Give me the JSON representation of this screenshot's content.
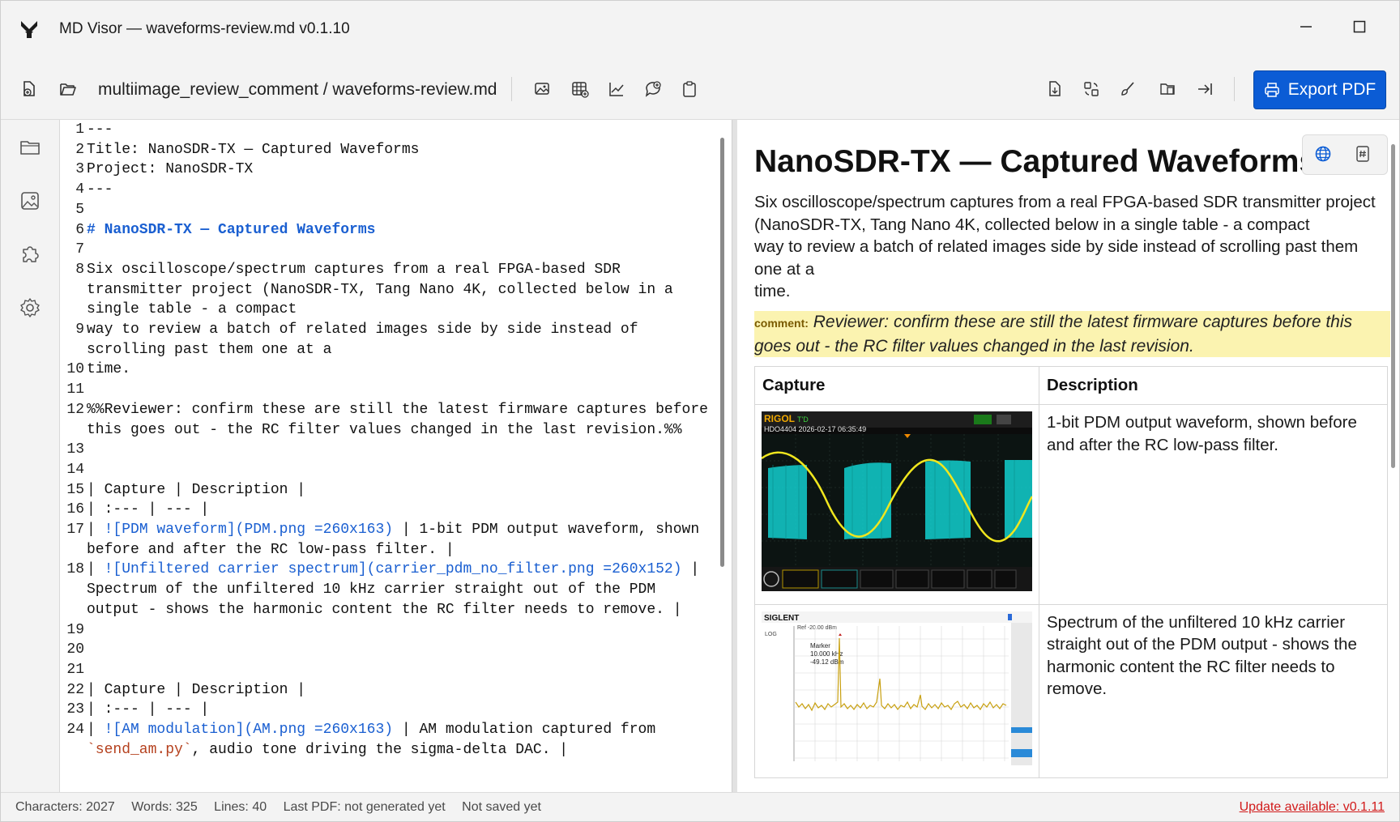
{
  "window": {
    "title": "MD Visor — waveforms-review.md v0.1.10"
  },
  "toolbar": {
    "breadcrumb": "multiimage_review_comment / waveforms-review.md",
    "export_label": "Export PDF"
  },
  "editor": {
    "lines": [
      {
        "n": "1",
        "segs": [
          {
            "t": "---"
          }
        ]
      },
      {
        "n": "2",
        "segs": [
          {
            "t": "Title: NanoSDR-TX — Captured Waveforms"
          }
        ]
      },
      {
        "n": "3",
        "segs": [
          {
            "t": "Project: NanoSDR-TX"
          }
        ]
      },
      {
        "n": "4",
        "segs": [
          {
            "t": "---"
          }
        ]
      },
      {
        "n": "5",
        "segs": [
          {
            "t": ""
          }
        ]
      },
      {
        "n": "6",
        "segs": [
          {
            "t": "# NanoSDR-TX — Captured Waveforms",
            "c": "md-h"
          }
        ]
      },
      {
        "n": "7",
        "segs": [
          {
            "t": ""
          }
        ]
      },
      {
        "n": "8",
        "segs": [
          {
            "t": "Six oscilloscope/spectrum captures from a real FPGA-based SDR transmitter project (NanoSDR-TX, Tang Nano 4K, collected below in a single table - a compact"
          }
        ]
      },
      {
        "n": "9",
        "segs": [
          {
            "t": "way to review a batch of related images side by side instead of scrolling past them one at a"
          }
        ]
      },
      {
        "n": "10",
        "segs": [
          {
            "t": "time."
          }
        ]
      },
      {
        "n": "11",
        "segs": [
          {
            "t": ""
          }
        ]
      },
      {
        "n": "12",
        "segs": [
          {
            "t": "%%Reviewer: confirm these are still the latest firmware captures before this goes out - the RC filter values changed in the last revision.%%"
          }
        ]
      },
      {
        "n": "13",
        "segs": [
          {
            "t": ""
          }
        ]
      },
      {
        "n": "14",
        "segs": [
          {
            "t": ""
          }
        ]
      },
      {
        "n": "15",
        "segs": [
          {
            "t": "| Capture | Description |"
          }
        ]
      },
      {
        "n": "16",
        "segs": [
          {
            "t": "| :--- | --- |"
          }
        ]
      },
      {
        "n": "17",
        "segs": [
          {
            "t": "| "
          },
          {
            "t": "![PDM waveform](PDM.png =260x163)",
            "c": "md-link"
          },
          {
            "t": " | 1-bit PDM output waveform, shown before and after the RC low-pass filter. |"
          }
        ]
      },
      {
        "n": "18",
        "segs": [
          {
            "t": "| "
          },
          {
            "t": "![Unfiltered carrier spectrum](carrier_pdm_no_filter.png =260x152)",
            "c": "md-link"
          },
          {
            "t": " | Spectrum of the unfiltered 10 kHz carrier straight out of the PDM output - shows the harmonic content the RC filter needs to remove. |"
          }
        ]
      },
      {
        "n": "19",
        "segs": [
          {
            "t": ""
          }
        ]
      },
      {
        "n": "20",
        "segs": [
          {
            "t": ""
          }
        ]
      },
      {
        "n": "21",
        "segs": [
          {
            "t": ""
          }
        ]
      },
      {
        "n": "22",
        "segs": [
          {
            "t": "| Capture | Description |"
          }
        ]
      },
      {
        "n": "23",
        "segs": [
          {
            "t": "| :--- | --- |"
          }
        ]
      },
      {
        "n": "24",
        "segs": [
          {
            "t": "| "
          },
          {
            "t": "![AM modulation](AM.png =260x163)",
            "c": "md-link"
          },
          {
            "t": " | AM modulation captured from "
          },
          {
            "t": "`send_am.py`",
            "c": "md-code"
          },
          {
            "t": ", audio tone driving the sigma-delta DAC. |"
          }
        ]
      }
    ]
  },
  "preview": {
    "title": "NanoSDR-TX — Captured Waveforms",
    "para_lines": [
      "Six oscilloscope/spectrum captures from a real FPGA-based SDR transmitter project",
      "(NanoSDR-TX, Tang Nano 4K, collected below in a single table - a compact",
      "way to review a batch of related images side by side instead of scrolling past them",
      "one at a",
      "time."
    ],
    "comment_tag": "comment:",
    "comment_text": "Reviewer: confirm these are still the latest firmware captures before this goes out - the RC filter values changed in the last revision.",
    "table": {
      "headers": [
        "Capture",
        "Description"
      ],
      "rows": [
        {
          "desc": "1-bit PDM output waveform, shown before and after the RC low-pass filter."
        },
        {
          "desc": "Spectrum of the unfiltered 10 kHz carrier straight out of the PDM output - shows the harmonic content the RC filter needs to remove."
        }
      ]
    },
    "scope": {
      "brand": "RIGOL",
      "status": "T'D",
      "model_time": "HDO4404 2026-02-17 06:35:49"
    },
    "analyzer": {
      "brand": "SIGLENT",
      "marker_label": "Marker",
      "marker_freq": "10.000 kHz",
      "marker_level": "-49.12 dBm",
      "ref_label": "Ref  -20.00 dBm",
      "scale_label": "LOG"
    }
  },
  "statusbar": {
    "characters": "Characters: 2027",
    "words": "Words: 325",
    "lines": "Lines: 40",
    "last_pdf": "Last PDF: not generated yet",
    "saved": "Not saved yet",
    "update": "Update available: v0.1.11"
  },
  "colors": {
    "accent": "#0b5cd5",
    "link": "#1a5fd1",
    "comment_bg": "#fbf3b0",
    "update_red": "#d11a1a",
    "scope_cyan": "#12d6d6",
    "scope_yellow": "#f0e61e"
  },
  "icons": {
    "toolbar_left": [
      "new-file-icon",
      "open-folder-icon"
    ],
    "toolbar_insert": [
      "insert-image-icon",
      "insert-table-icon",
      "insert-chart-icon",
      "insert-comment-icon",
      "paste-icon"
    ],
    "toolbar_right": [
      "file-export-icon",
      "sync-icon",
      "brush-icon",
      "compare-icon",
      "collapse-right-icon"
    ],
    "rail": [
      "folder-icon",
      "image-icon",
      "puzzle-icon",
      "settings-icon"
    ],
    "preview": [
      "globe-icon",
      "hash-icon"
    ]
  }
}
